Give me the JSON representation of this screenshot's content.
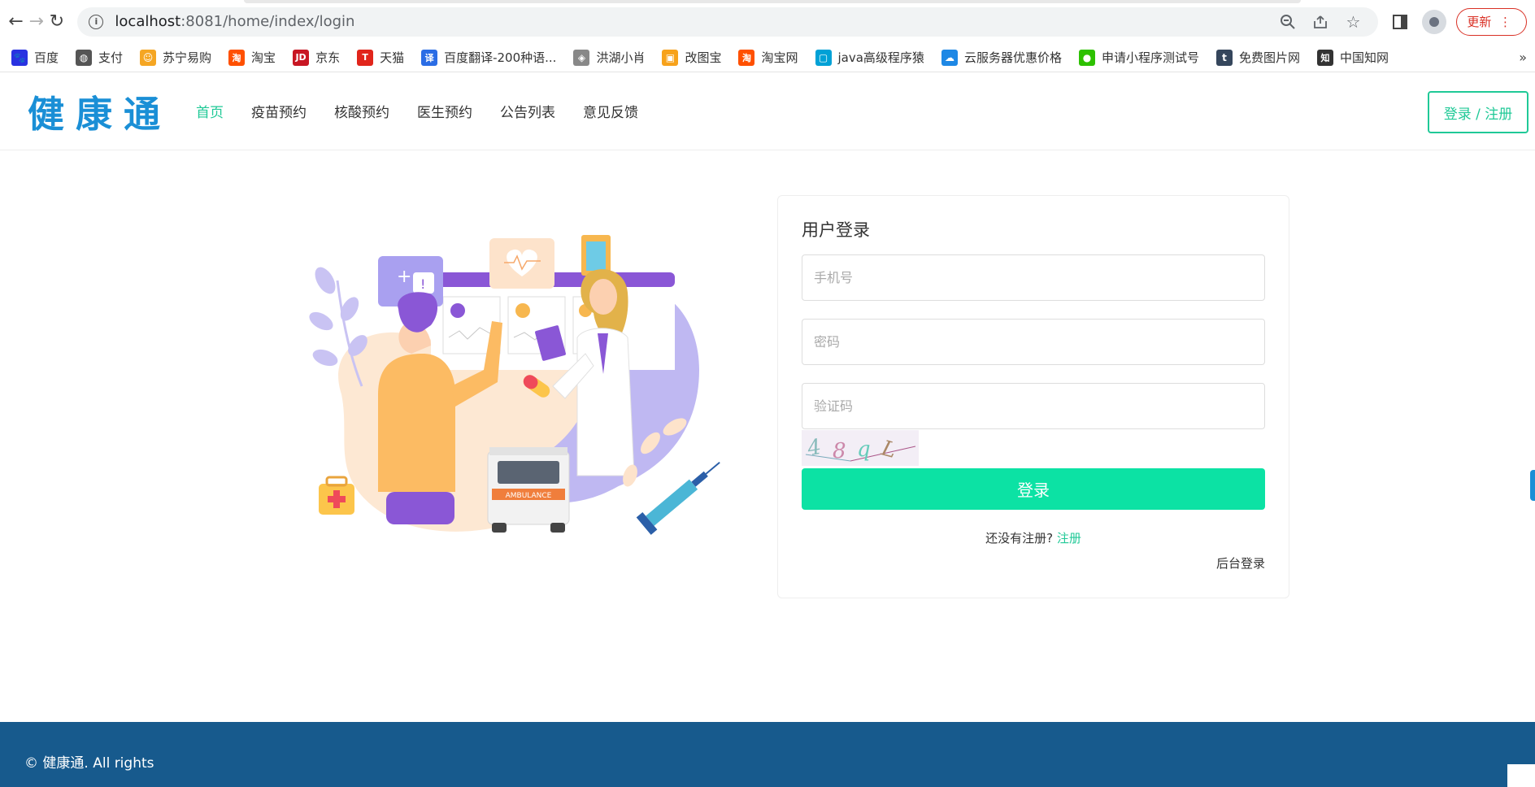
{
  "browser": {
    "url_host": "localhost",
    "url_rest": ":8081/home/index/login",
    "update_label": "更新",
    "bookmarks": [
      {
        "label": "百度",
        "icon": "baidu-paw-icon",
        "color": "#2932e1"
      },
      {
        "label": "支付",
        "icon": "globe-icon",
        "color": "#555555"
      },
      {
        "label": "苏宁易购",
        "icon": "lion-icon",
        "color": "#f5a623"
      },
      {
        "label": "淘宝",
        "icon": "taobao-icon",
        "color": "#ff5000"
      },
      {
        "label": "京东",
        "icon": "jd-icon",
        "color": "#c81623"
      },
      {
        "label": "天猫",
        "icon": "tmall-icon",
        "color": "#e1251b"
      },
      {
        "label": "百度翻译-200种语...",
        "icon": "translate-icon",
        "color": "#2b6de5"
      },
      {
        "label": "洪湖小肖",
        "icon": "shield-icon",
        "color": "#888888"
      },
      {
        "label": "改图宝",
        "icon": "gaitubao-icon",
        "color": "#f7a21b"
      },
      {
        "label": "淘宝网",
        "icon": "taobao-icon",
        "color": "#ff5000"
      },
      {
        "label": "java高级程序猿",
        "icon": "bilibili-icon",
        "color": "#00a1d6"
      },
      {
        "label": "云服务器优惠价格",
        "icon": "cloud-icon",
        "color": "#1e88e5"
      },
      {
        "label": "申请小程序测试号",
        "icon": "wechat-icon",
        "color": "#2dc100"
      },
      {
        "label": "免费图片网",
        "icon": "tumblr-icon",
        "color": "#35465c"
      },
      {
        "label": "中国知网",
        "icon": "cnki-icon",
        "color": "#333333"
      }
    ],
    "more": "»"
  },
  "header": {
    "logo": "健康通",
    "nav": [
      "首页",
      "疫苗预约",
      "核酸预约",
      "医生预约",
      "公告列表",
      "意见反馈"
    ],
    "login_register": "登录 / 注册"
  },
  "login": {
    "title": "用户登录",
    "phone_placeholder": "手机号",
    "password_placeholder": "密码",
    "captcha_placeholder": "验证码",
    "captcha_text": "48qL",
    "submit": "登录",
    "no_account": "还没有注册?",
    "register_link": "注册",
    "admin_login": "后台登录"
  },
  "footer": {
    "copyright": "© 健康通. All rights"
  }
}
